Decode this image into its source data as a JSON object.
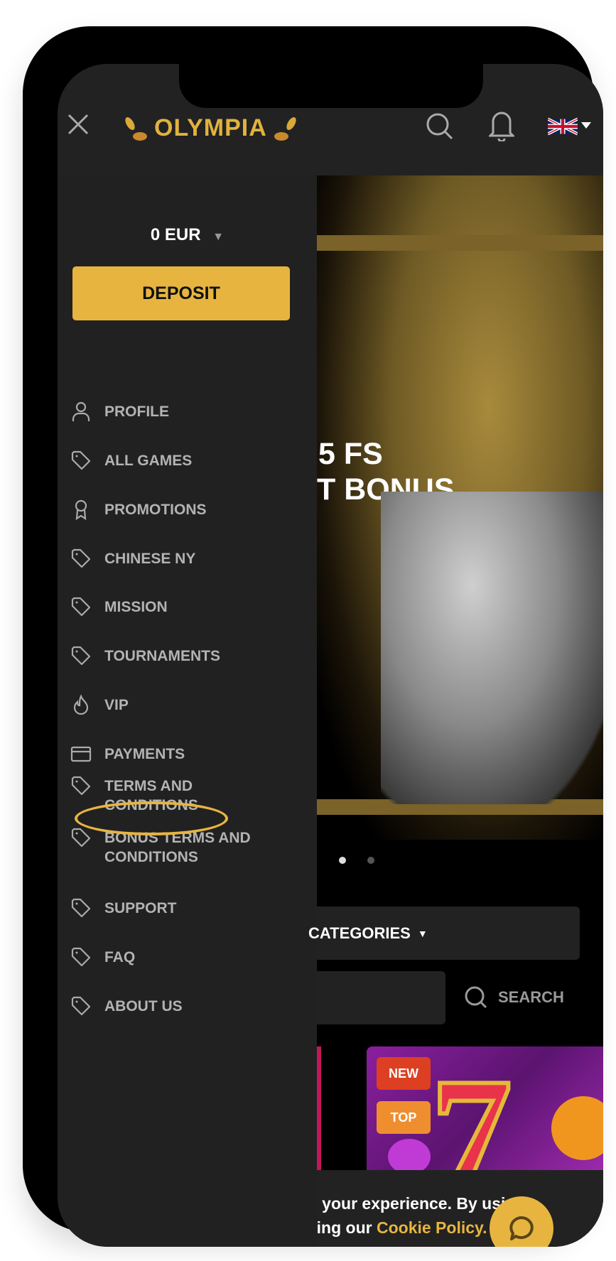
{
  "header": {
    "logo_text": "OLYMPIA",
    "close_icon": "close-icon",
    "search_icon": "search-icon",
    "bell_icon": "bell-icon",
    "language": "UK flag"
  },
  "sidebar": {
    "balance": "0 EUR",
    "deposit_label": "DEPOSIT",
    "items": [
      {
        "label": "PROFILE",
        "icon": "user-icon"
      },
      {
        "label": "ALL GAMES",
        "icon": "tag-icon"
      },
      {
        "label": "PROMOTIONS",
        "icon": "award-icon"
      },
      {
        "label": "CHINESE NY",
        "icon": "tag-icon"
      },
      {
        "label": "MISSION",
        "icon": "tag-icon"
      },
      {
        "label": "TOURNAMENTS",
        "icon": "tag-icon"
      },
      {
        "label": "VIP",
        "icon": "flame-icon"
      },
      {
        "label": "PAYMENTS",
        "icon": "card-icon",
        "highlighted": true
      },
      {
        "label": "TERMS AND CONDITIONS",
        "icon": "tag-icon"
      },
      {
        "label": "BONUS TERMS AND CONDITIONS",
        "icon": "tag-icon"
      },
      {
        "label": "SUPPORT",
        "icon": "tag-icon"
      },
      {
        "label": "FAQ",
        "icon": "tag-icon"
      },
      {
        "label": "ABOUT US",
        "icon": "tag-icon"
      }
    ]
  },
  "banner": {
    "line1": "5 FS",
    "line2": "T BONUS",
    "slides": 2,
    "active_slide": 1
  },
  "filters": {
    "categories_label": "CATEGORIES",
    "search_label": "SEARCH"
  },
  "game_tile": {
    "badges": [
      "NEW",
      "TOP"
    ]
  },
  "cookie": {
    "line1": "e your experience. By usi",
    "line2_prefix": "ting our ",
    "link": "Cookie Policy."
  },
  "colors": {
    "accent": "#e7b53f",
    "sidebar": "#212121",
    "badge_new": "#dd3f23",
    "badge_top": "#ef8e2f"
  }
}
